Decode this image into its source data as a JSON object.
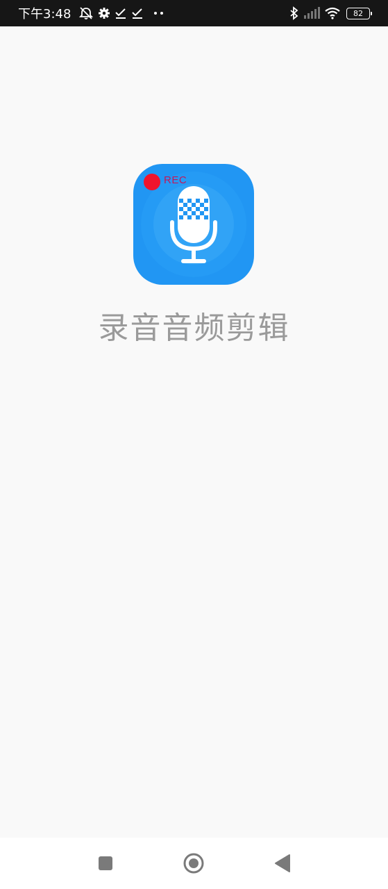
{
  "status_bar": {
    "time": "下午3:48",
    "battery": "82",
    "icons": [
      "alarm-off-icon",
      "gear-icon",
      "check-icon",
      "check-icon",
      "more-dots-icon",
      "bluetooth-icon",
      "signal-icon",
      "wifi-icon",
      "battery-icon"
    ]
  },
  "splash": {
    "app_title": "录音音频剪辑",
    "icon": {
      "rec_label": "REC",
      "background": "#2196f3",
      "rec_dot_color": "#f0142d"
    }
  },
  "nav_bar": {
    "buttons": [
      "recent-apps-icon",
      "home-icon",
      "back-icon"
    ]
  }
}
